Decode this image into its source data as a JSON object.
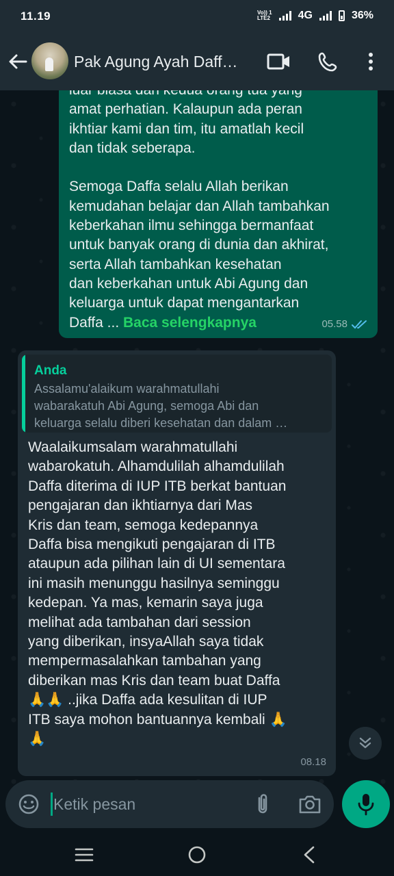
{
  "status_bar": {
    "time": "11.19",
    "network": "4G",
    "volte_top": "Vo)) 1",
    "volte_bottom": "LTE2",
    "battery": "36%"
  },
  "header": {
    "contact_name": "Pak Agung Ayah Daff…"
  },
  "messages": {
    "outgoing": {
      "text": "luar biasa dan kedua orang tua yang\namat perhatian. Kalaupun ada peran\nikhtiar kami dan tim, itu amatlah kecil\ndan tidak seberapa.\n\nSemoga Daffa selalu Allah berikan\nkemudahan belajar dan Allah tambahkan\nkeberkahan ilmu sehingga bermanfaat\nuntuk banyak orang di dunia dan akhirat,\nserta Allah tambahkan kesehatan\ndan keberkahan untuk Abi Agung dan\nkeluarga untuk dapat mengantarkan\nDaffa ... ",
      "read_more": "Baca selengkapnya",
      "time": "05.58",
      "status_color": "#53bdeb"
    },
    "incoming": {
      "quote_author": "Anda",
      "quote_text": "Assalamu'alaikum warahmatullahi\nwabarakatuh Abi Agung, semoga Abi dan\nkeluarga selalu diberi kesehatan dan dalam …",
      "text": "Waalaikumsalam warahmatullahi\nwabarokatuh. Alhamdulilah alhamdulilah\nDaffa diterima di IUP ITB berkat bantuan\npengajaran dan ikhtiarnya dari Mas\nKris dan team, semoga kedepannya\nDaffa bisa mengikuti pengajaran di ITB\nataupun ada pilihan lain di UI sementara\nini masih menunggu hasilnya seminggu\nkedepan. Ya mas, kemarin saya juga\nmelihat ada tambahan dari session\nyang diberikan, insyaAllah saya tidak\nmempermasalahkan tambahan yang\ndiberikan mas Kris dan team buat Daffa\n🙏🙏 ..jika Daffa ada kesulitan di IUP\nITB saya mohon bantuannya kembali 🙏\n🙏",
      "time": "08.18"
    }
  },
  "composer": {
    "placeholder": "Ketik pesan"
  },
  "colors": {
    "accent": "#00a884",
    "outgoing_bubble": "#005c4b",
    "incoming_bubble": "#1f2c34",
    "background": "#0b141a"
  },
  "icons": [
    "back-arrow-icon",
    "video-call-icon",
    "voice-call-icon",
    "more-vert-icon",
    "double-check-icon",
    "chevron-double-down-icon",
    "emoji-icon",
    "attachment-icon",
    "camera-icon",
    "microphone-icon",
    "recent-apps-icon",
    "home-icon",
    "back-nav-icon"
  ]
}
